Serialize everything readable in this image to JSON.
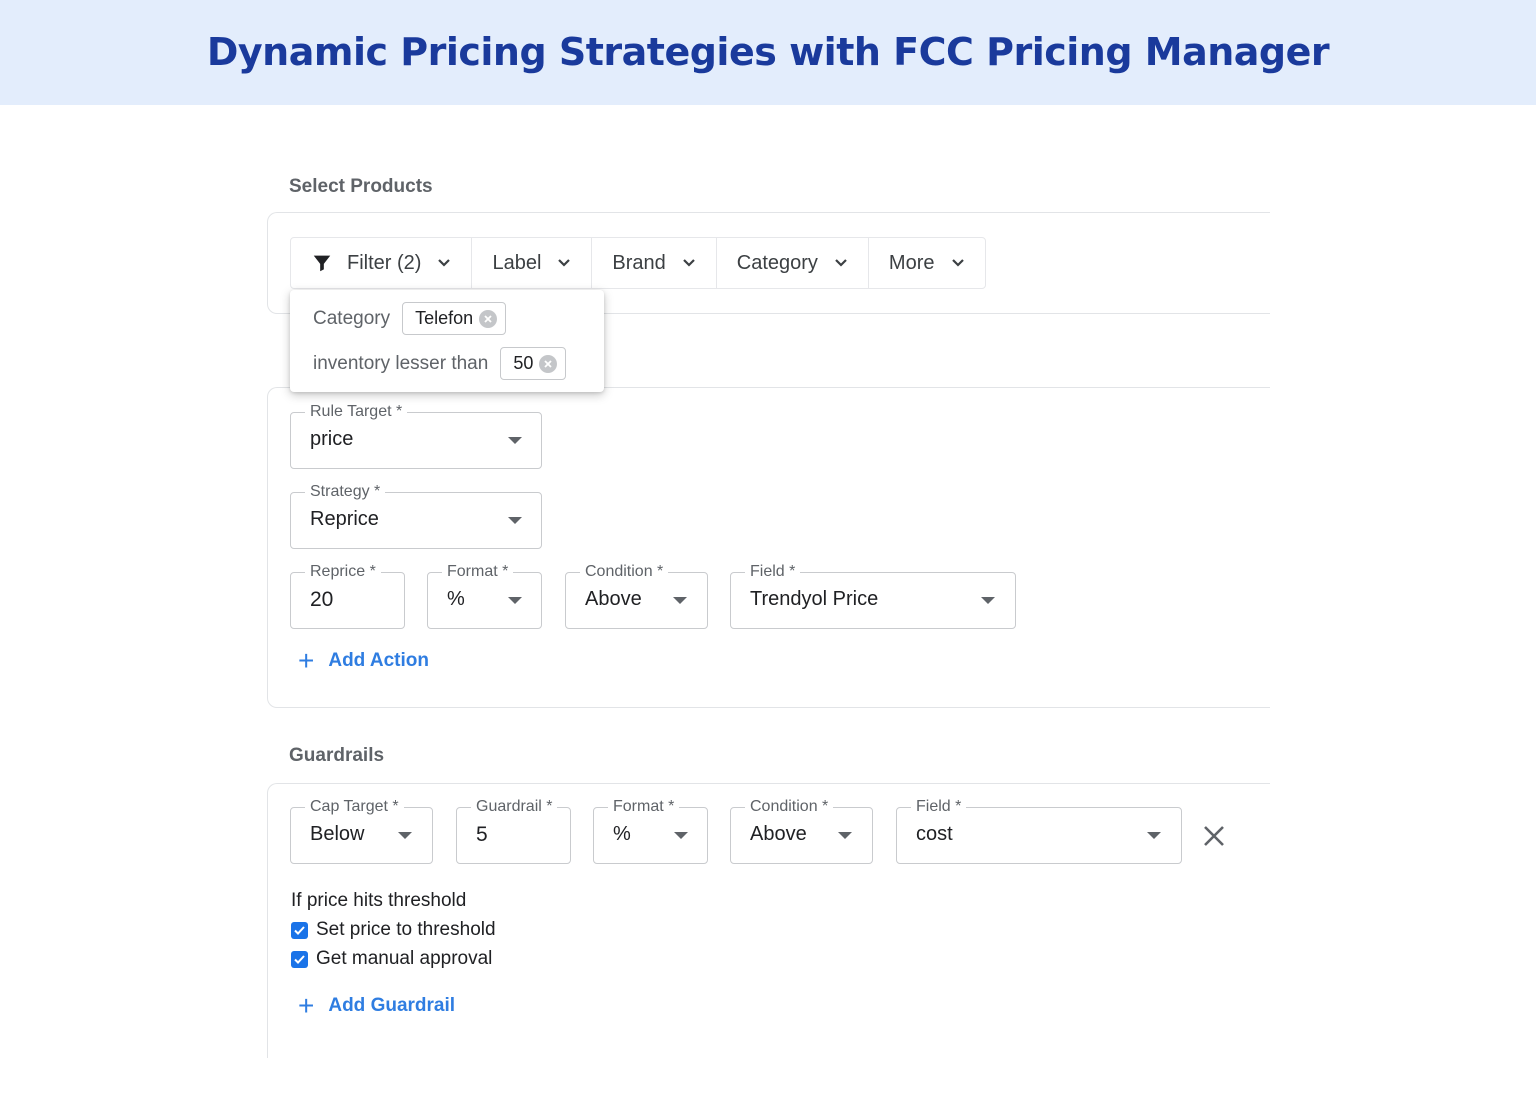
{
  "banner": {
    "title": "Dynamic Pricing Strategies with FCC Pricing Manager"
  },
  "select_products": {
    "title": "Select Products",
    "filters": [
      {
        "label": "Filter (2)",
        "icon": "filter-icon"
      },
      {
        "label": "Label"
      },
      {
        "label": "Brand"
      },
      {
        "label": "Category"
      },
      {
        "label": "More"
      }
    ],
    "active_filters": [
      {
        "field": "Category",
        "value": "Telefon"
      },
      {
        "field": "inventory lesser than",
        "value": "50"
      }
    ]
  },
  "rule": {
    "rule_target": {
      "label": "Rule Target *",
      "value": "price"
    },
    "strategy": {
      "label": "Strategy *",
      "value": "Reprice"
    },
    "reprice": {
      "label": "Reprice *",
      "value": "20"
    },
    "format": {
      "label": "Format *",
      "value": "%"
    },
    "condition": {
      "label": "Condition *",
      "value": "Above"
    },
    "field": {
      "label": "Field *",
      "value": "Trendyol Price"
    },
    "add_action": "Add Action"
  },
  "guardrails": {
    "title": "Guardrails",
    "cap_target": {
      "label": "Cap Target *",
      "value": "Below"
    },
    "guardrail": {
      "label": "Guardrail *",
      "value": "5"
    },
    "format": {
      "label": "Format *",
      "value": "%"
    },
    "condition": {
      "label": "Condition *",
      "value": "Above"
    },
    "field": {
      "label": "Field *",
      "value": "cost"
    },
    "threshold_title": "If price hits threshold",
    "options": [
      {
        "label": "Set price to threshold",
        "checked": true
      },
      {
        "label": "Get manual approval",
        "checked": true
      }
    ],
    "add_guardrail": "Add Guardrail"
  },
  "colors": {
    "accent": "#1a73e8",
    "link": "#2f7de1",
    "banner_bg": "#e3edfc",
    "banner_text": "#1a3a9c"
  }
}
